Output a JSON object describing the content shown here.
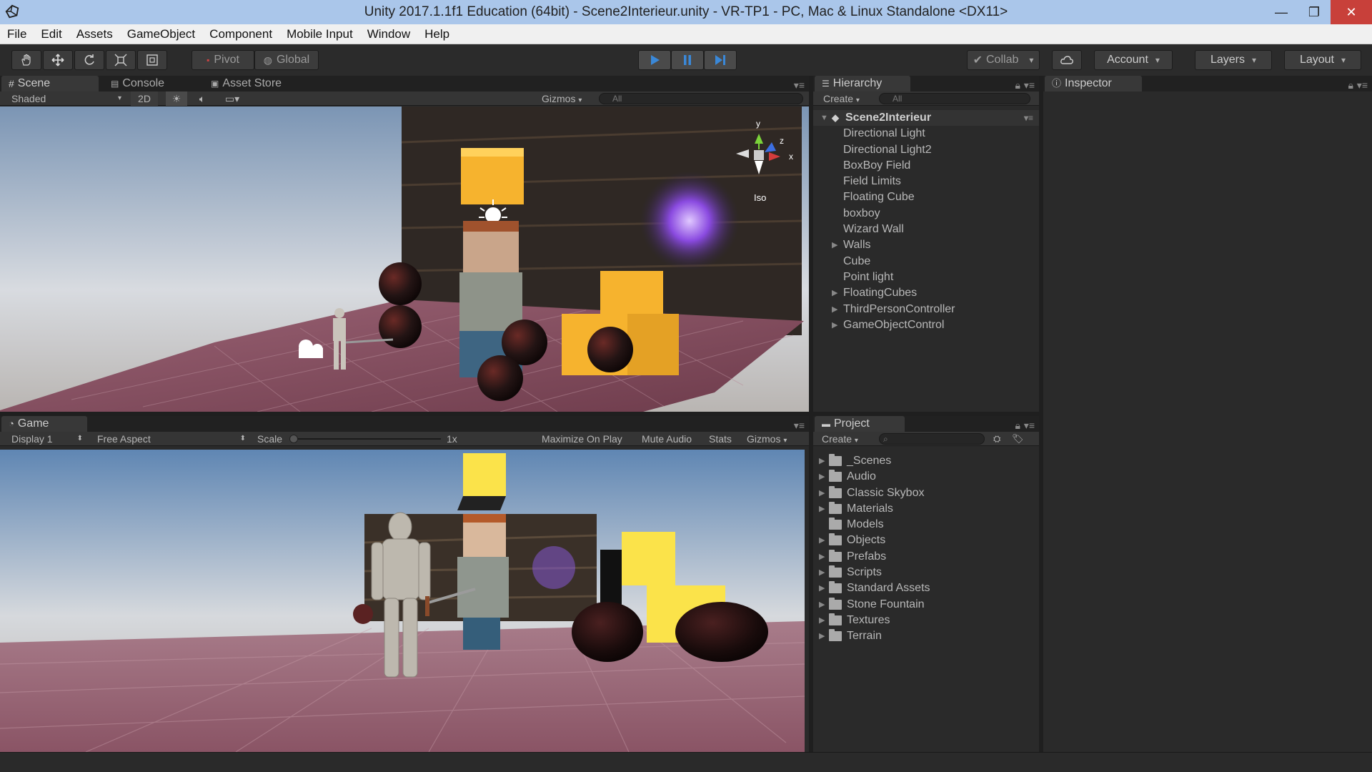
{
  "window": {
    "title": "Unity 2017.1.1f1 Education (64bit) - Scene2Interieur.unity - VR-TP1 - PC, Mac & Linux Standalone <DX11>",
    "minimize": "—",
    "maximize": "❐",
    "close": "✕"
  },
  "menu": [
    "File",
    "Edit",
    "Assets",
    "GameObject",
    "Component",
    "Mobile Input",
    "Window",
    "Help"
  ],
  "toolbar": {
    "pivot": "Pivot",
    "global": "Global",
    "collab": "Collab",
    "account": "Account",
    "layers": "Layers",
    "layout": "Layout",
    "play_color": "#3a88d8"
  },
  "scene": {
    "tabs": [
      "Scene",
      "Console",
      "Asset Store"
    ],
    "shading": "Shaded",
    "mode_2d": "2D",
    "gizmos": "Gizmos",
    "search_placeholder": "All",
    "gizmo_axes": {
      "y": "y",
      "z": "z",
      "x": "x"
    },
    "projection": "Iso"
  },
  "game": {
    "tab": "Game",
    "display": "Display 1",
    "aspect": "Free Aspect",
    "scale_label": "Scale",
    "scale_value": "1x",
    "maximize": "Maximize On Play",
    "mute": "Mute Audio",
    "stats": "Stats",
    "gizmos": "Gizmos"
  },
  "hierarchy": {
    "tab": "Hierarchy",
    "create": "Create",
    "search_placeholder": "All",
    "scene_name": "Scene2Interieur",
    "items": [
      {
        "label": "Directional Light",
        "expandable": false
      },
      {
        "label": "Directional Light2",
        "expandable": false
      },
      {
        "label": "BoxBoy Field",
        "expandable": false
      },
      {
        "label": "Field Limits",
        "expandable": false
      },
      {
        "label": "Floating Cube",
        "expandable": false
      },
      {
        "label": "boxboy",
        "expandable": false
      },
      {
        "label": "Wizard Wall",
        "expandable": false
      },
      {
        "label": "Walls",
        "expandable": true
      },
      {
        "label": "Cube",
        "expandable": false
      },
      {
        "label": "Point light",
        "expandable": false
      },
      {
        "label": "FloatingCubes",
        "expandable": true
      },
      {
        "label": "ThirdPersonController",
        "expandable": true
      },
      {
        "label": "GameObjectControl",
        "expandable": true
      }
    ]
  },
  "inspector": {
    "tab": "Inspector"
  },
  "project": {
    "tab": "Project",
    "create": "Create",
    "folders": [
      {
        "label": "_Scenes",
        "expandable": true
      },
      {
        "label": "Audio",
        "expandable": true
      },
      {
        "label": "Classic Skybox",
        "expandable": true
      },
      {
        "label": "Materials",
        "expandable": true
      },
      {
        "label": "Models",
        "expandable": false
      },
      {
        "label": "Objects",
        "expandable": true
      },
      {
        "label": "Prefabs",
        "expandable": true
      },
      {
        "label": "Scripts",
        "expandable": true
      },
      {
        "label": "Standard Assets",
        "expandable": true
      },
      {
        "label": "Stone Fountain",
        "expandable": true
      },
      {
        "label": "Textures",
        "expandable": true
      },
      {
        "label": "Terrain",
        "expandable": true
      }
    ]
  }
}
